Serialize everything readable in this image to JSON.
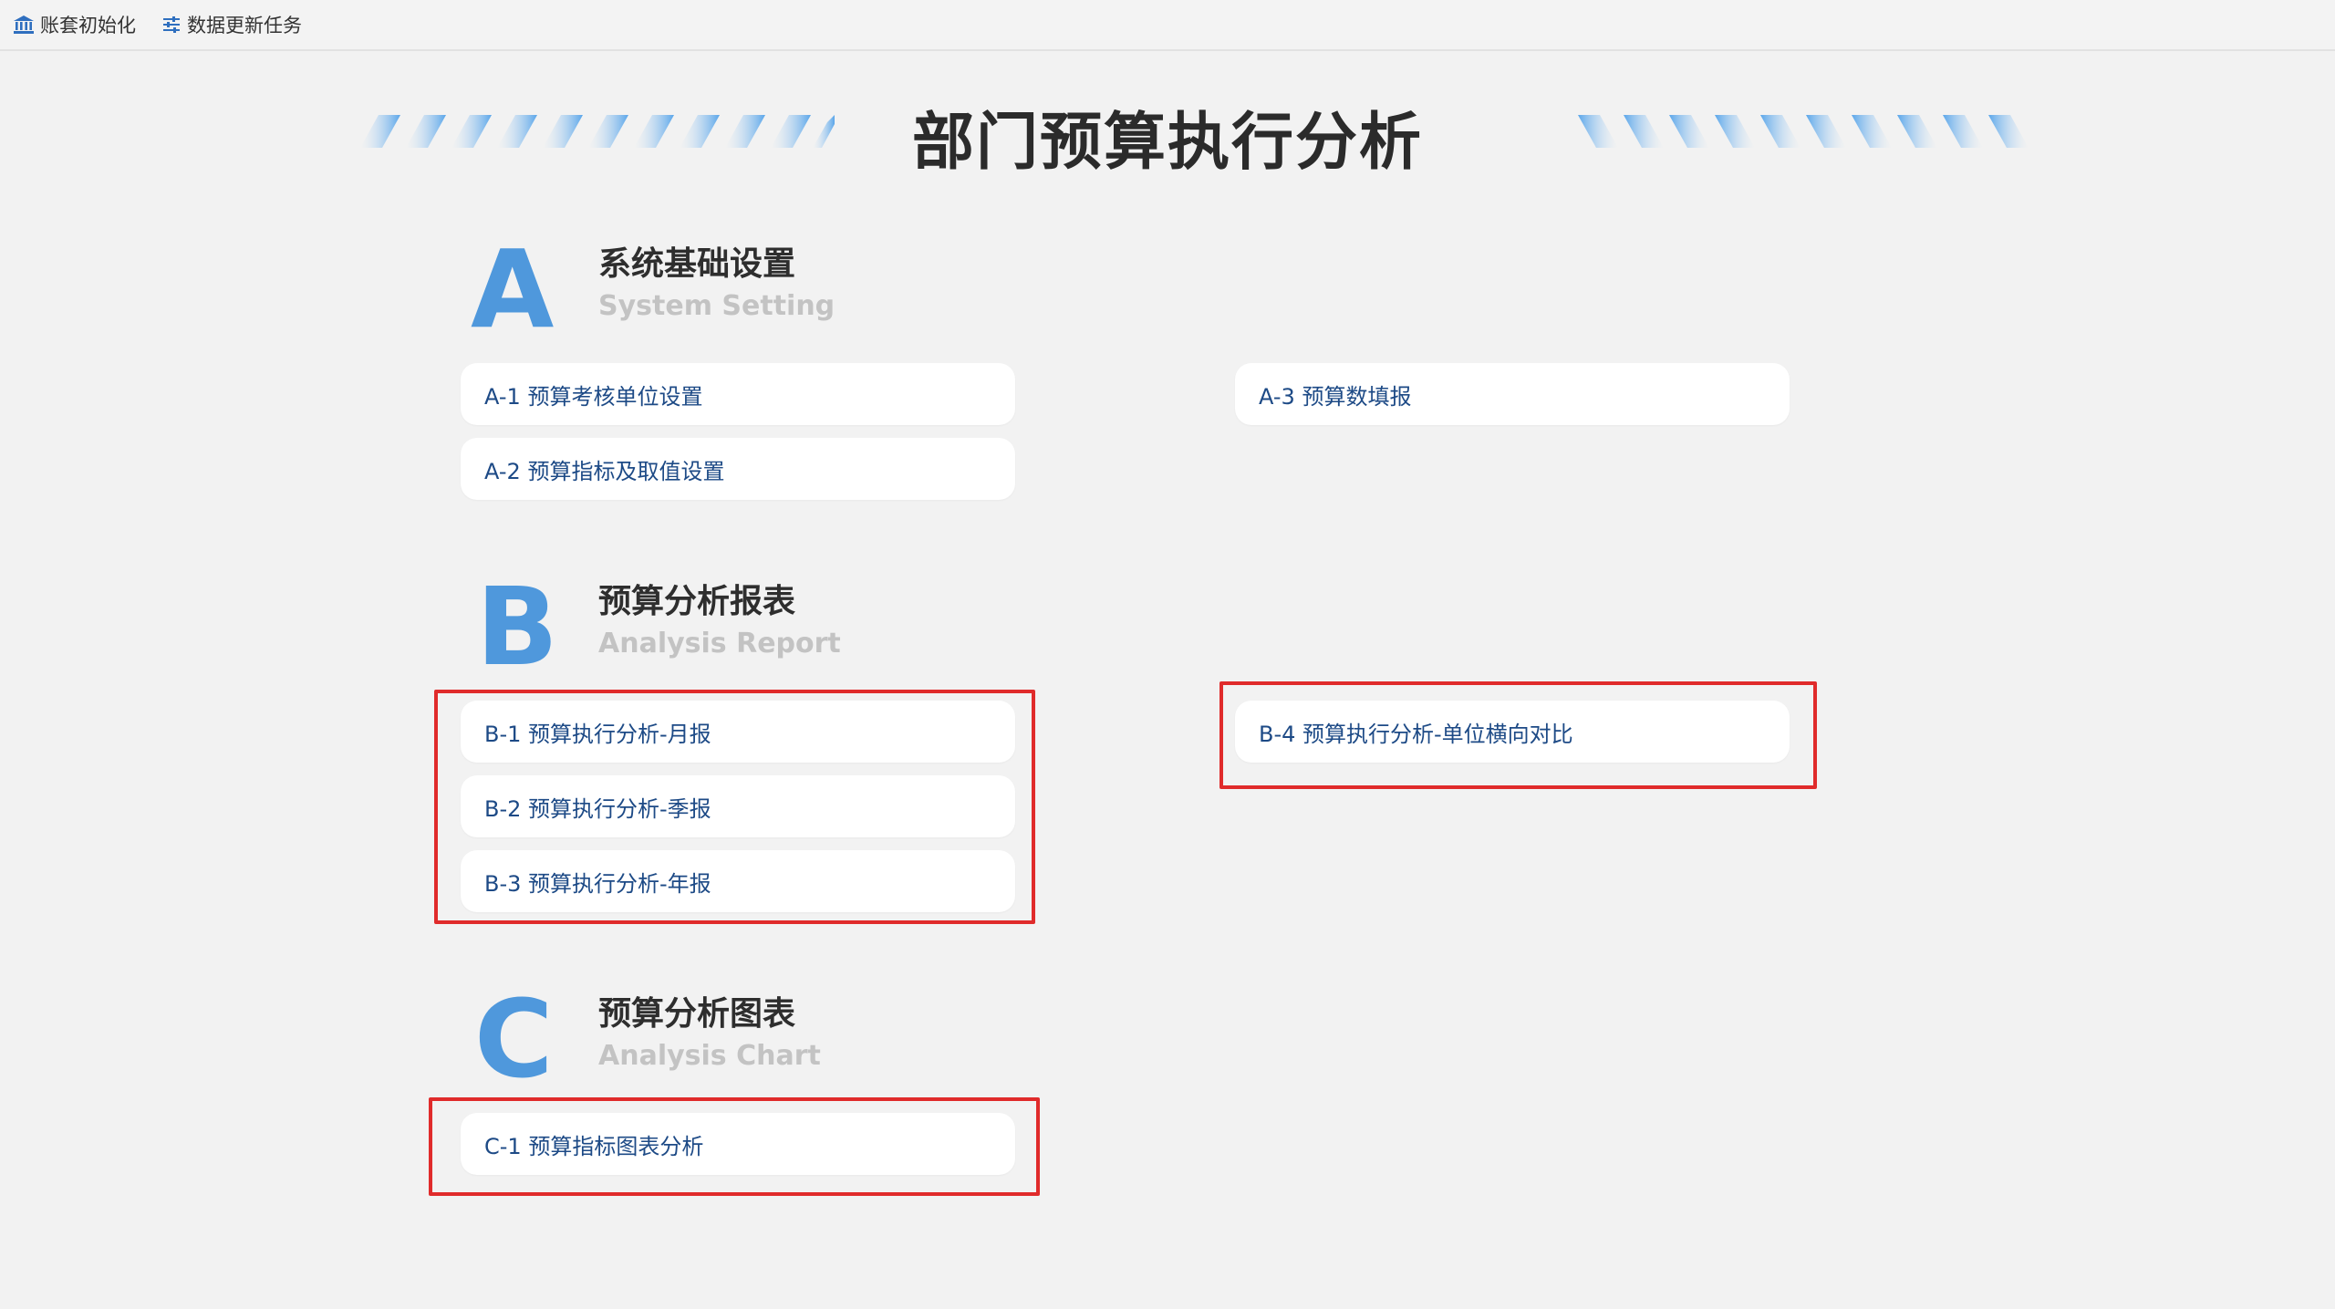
{
  "toolbar": {
    "items": [
      {
        "label": "账套初始化",
        "icon": "bank-icon"
      },
      {
        "label": "数据更新任务",
        "icon": "sliders-icon"
      }
    ]
  },
  "page_title": "部门预算执行分析",
  "sections": [
    {
      "letter": "A",
      "title": "系统基础设置",
      "subtitle": "System Setting",
      "items": [
        "A-1 预算考核单位设置",
        "A-2 预算指标及取值设置",
        "A-3 预算数填报"
      ]
    },
    {
      "letter": "B",
      "title": "预算分析报表",
      "subtitle": "Analysis Report",
      "items": [
        "B-1 预算执行分析-月报",
        "B-2 预算执行分析-季报",
        "B-3 预算执行分析-年报",
        "B-4 预算执行分析-单位横向对比"
      ]
    },
    {
      "letter": "C",
      "title": "预算分析图表",
      "subtitle": "Analysis Chart",
      "items": [
        "C-1 预算指标图表分析"
      ]
    }
  ],
  "colors": {
    "accent": "#4f98dc",
    "link_text": "#1d4a86",
    "highlight": "#e02b2b",
    "background": "#f2f2f2"
  }
}
